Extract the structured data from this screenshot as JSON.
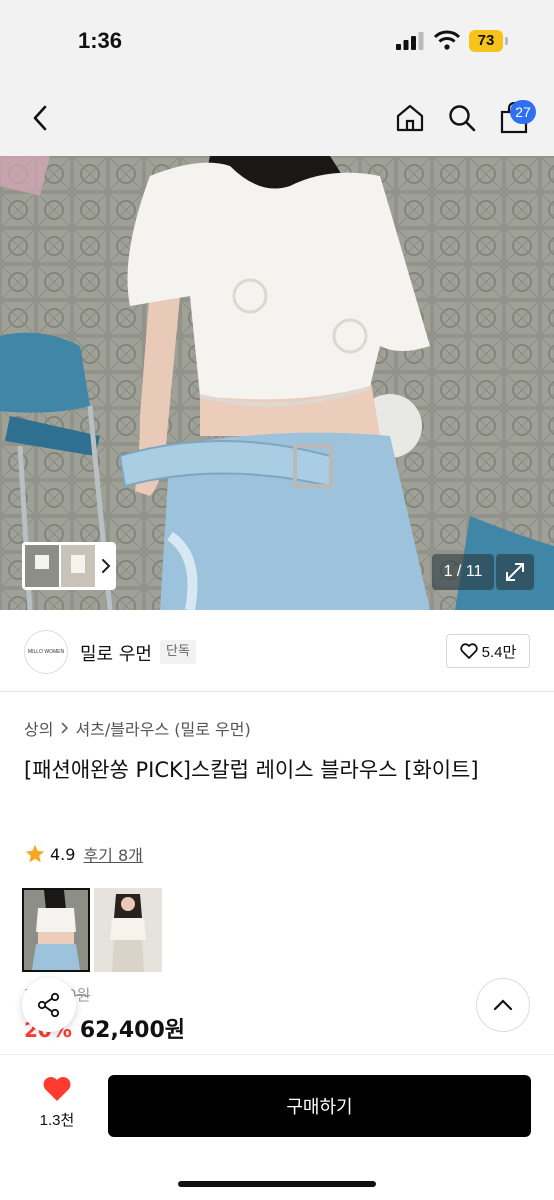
{
  "status": {
    "time": "1:36",
    "battery": "73"
  },
  "nav": {
    "cart_count": "27"
  },
  "gallery": {
    "counter": "1 / 11"
  },
  "brand": {
    "name": "밀로 우먼",
    "logo_text": "MILLO WOMEN",
    "tag": "단독",
    "likes": "5.4만"
  },
  "breadcrumb": {
    "category": "상의",
    "subcategory": "셔츠/블라우스 (밀로 우먼)"
  },
  "product": {
    "title": "[패션애완쏭 PICK]스칼럽 레이스 블라우스 [화이트]",
    "rating": "4.9",
    "reviews": "후기 8개",
    "original_price": "78,000원",
    "discount": "20%",
    "sale_price": "62,400원"
  },
  "bottom": {
    "wish_count": "1.3천",
    "buy_label": "구매하기"
  },
  "colors": {
    "accent_red": "#ff3b30",
    "badge_blue": "#2f6ff0",
    "star": "#f5a623",
    "battery": "#f7c31a"
  }
}
